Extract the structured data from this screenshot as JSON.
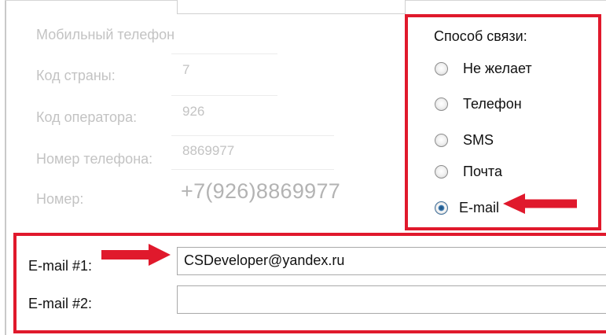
{
  "window": {
    "title": ""
  },
  "phone": {
    "section_title": "Мобильный телефон",
    "country_code_label": "Код страны:",
    "country_code_value": "7",
    "operator_code_label": "Код оператора:",
    "operator_code_value": "926",
    "phone_number_label": "Номер телефона:",
    "phone_number_value": "8869977",
    "full_number_label": "Номер:",
    "full_number_value": "+7(926)8869977"
  },
  "contact_method": {
    "title": "Способ связи:",
    "options": [
      {
        "label": "Не желает",
        "checked": false
      },
      {
        "label": "Телефон",
        "checked": false
      },
      {
        "label": "SMS",
        "checked": false
      },
      {
        "label": "Почта",
        "checked": false
      },
      {
        "label": "E-mail",
        "checked": true
      }
    ]
  },
  "email": {
    "email1_label": "E-mail #1:",
    "email1_value": "CSDeveloper@yandex.ru",
    "email2_label": "E-mail #2:",
    "email2_value": ""
  },
  "colors": {
    "highlight_red": "#e0192c",
    "disabled_text": "#c3c3c3",
    "radio_selected": "#2f6ea6"
  }
}
